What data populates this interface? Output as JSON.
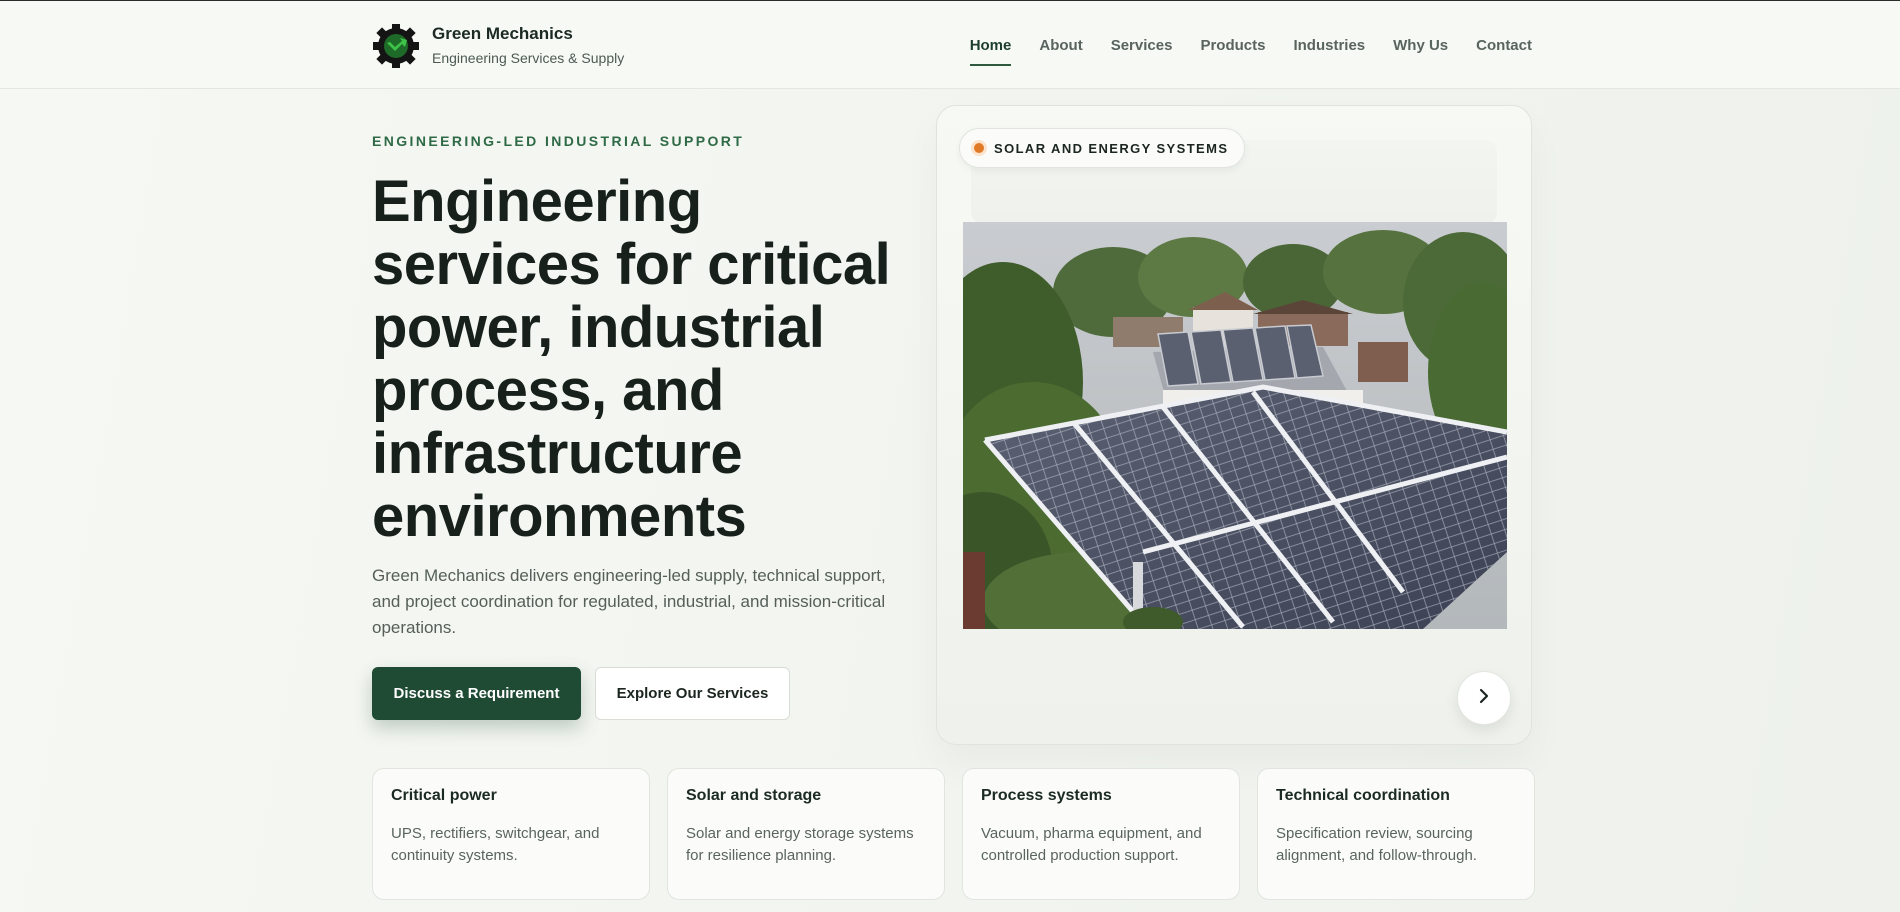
{
  "brand": {
    "name": "Green Mechanics",
    "tagline": "Engineering Services & Supply",
    "logo_icon": "gear-wrench-icon",
    "colors": {
      "logo_bg": "#141414",
      "logo_accent": "#2fa33c"
    }
  },
  "nav": {
    "items": [
      {
        "label": "Home",
        "active": true
      },
      {
        "label": "About"
      },
      {
        "label": "Services"
      },
      {
        "label": "Products"
      },
      {
        "label": "Industries"
      },
      {
        "label": "Why Us"
      },
      {
        "label": "Contact"
      }
    ]
  },
  "hero": {
    "eyebrow": "ENGINEERING-LED INDUSTRIAL SUPPORT",
    "title": "Engineering services for critical power, industrial process, and infrastructure environments",
    "lede": "Green Mechanics delivers engineering-led supply, technical support, and project coordination for regulated, industrial, and mission-critical operations.",
    "primary_cta": "Discuss a Requirement",
    "secondary_cta": "Explore Our Services",
    "colors": {
      "primary": "#1f4a33",
      "accent_dot": "#e07a28"
    }
  },
  "showcase": {
    "badge": "SOLAR AND ENERGY SYSTEMS",
    "image_subject": "rooftop solar panel array among trees and houses",
    "next_icon": "chevron-right-icon"
  },
  "features": [
    {
      "title": "Critical power",
      "text": "UPS, rectifiers, switchgear, and continuity systems."
    },
    {
      "title": "Solar and storage",
      "text": "Solar and energy storage systems for resilience planning."
    },
    {
      "title": "Process systems",
      "text": "Vacuum, pharma equipment, and controlled production support."
    },
    {
      "title": "Technical coordination",
      "text": "Specification review, sourcing alignment, and follow-through."
    }
  ]
}
